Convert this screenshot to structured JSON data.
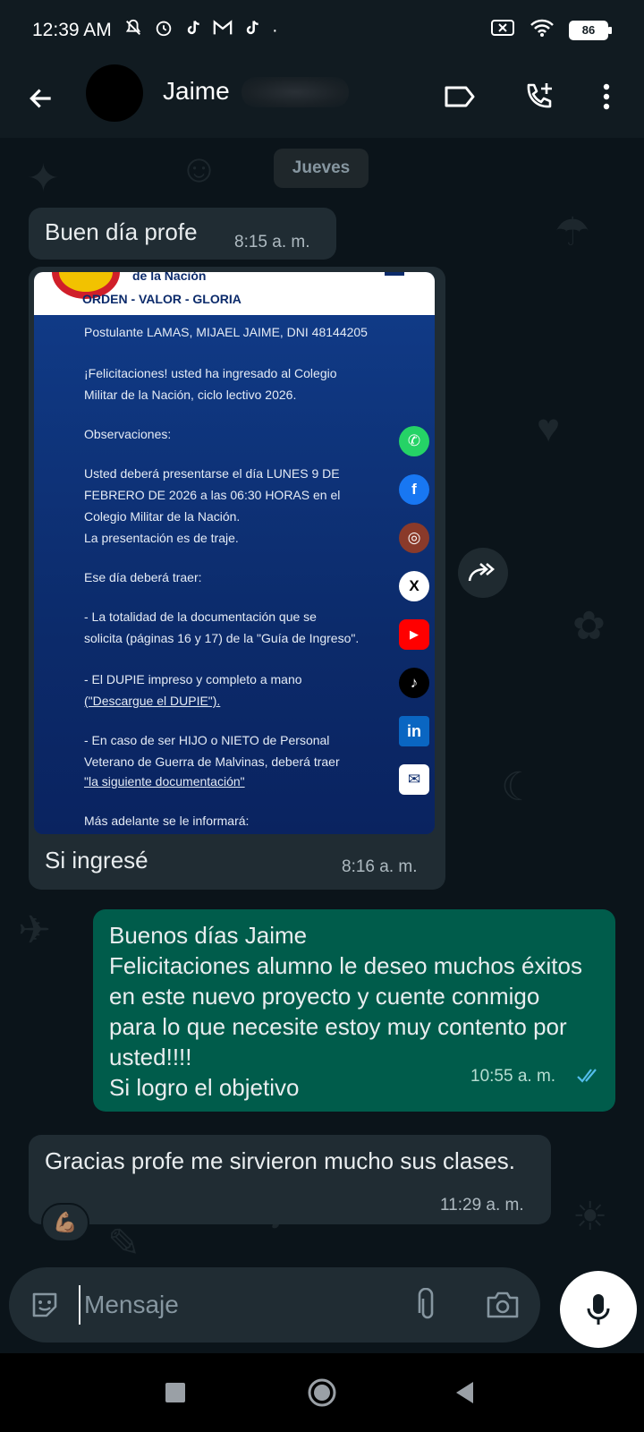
{
  "status_bar": {
    "time": "12:39 AM",
    "battery": "86",
    "icons": [
      "mute-icon",
      "alarm-icon",
      "tiktok-icon",
      "gmail-icon",
      "tiktok-icon",
      "dot-icon",
      "no-sim-icon",
      "wifi-icon",
      "battery-icon"
    ]
  },
  "header": {
    "contact_name": "Jaime",
    "icons": [
      "back-arrow-icon",
      "label-icon",
      "add-call-icon",
      "more-vert-icon"
    ]
  },
  "chat": {
    "date_chip": "Jueves",
    "messages": [
      {
        "direction": "in",
        "text": "Buen día profe",
        "time": "8:15 a. m."
      },
      {
        "direction": "in",
        "type": "image",
        "caption": "Si ingresé",
        "time": "8:16 a. m.",
        "image": {
          "header_fragment": "de la Nación",
          "motto": "ORDEN - VALOR - GLORIA",
          "lines": [
            "Postulante LAMAS, MIJAEL JAIME, DNI 48144205",
            "¡Felicitaciones! usted ha ingresado al Colegio",
            "Militar de la Nación, ciclo lectivo 2026.",
            "Observaciones:",
            "Usted deberá presentarse el día LUNES 9 DE",
            "FEBRERO DE 2026 a las 06:30 HORAS en el",
            "Colegio Militar de la Nación.",
            "La presentación es de traje.",
            "Ese día deberá traer:",
            "- La totalidad de la documentación que se",
            "solicita (páginas 16 y 17) de la \"Guía de Ingreso\".",
            "- El DUPIE impreso y completo a mano",
            "(\"Descargue el DUPIE\").",
            "- En caso de ser HIJO o NIETO de Personal",
            "Veterano de Guerra de Malvinas, deberá traer",
            "\"la siguiente documentación\"",
            "Más adelante se le informará:"
          ],
          "social_icons": [
            "whatsapp-icon",
            "facebook-icon",
            "instagram-icon",
            "x-icon",
            "youtube-icon",
            "tiktok-icon",
            "linkedin-icon",
            "mail-icon"
          ]
        }
      },
      {
        "direction": "out",
        "text": "Buenos días Jaime\nFelicitaciones alumno le deseo muchos éxitos en este nuevo proyecto y cuente conmigo para lo que necesite estoy muy contento por usted!!!!\nSi logro el objetivo",
        "time": "10:55 a. m.",
        "status": "read"
      },
      {
        "direction": "in",
        "text": "Gracias profe me sirvieron mucho sus clases.",
        "time": "11:29 a. m.",
        "reaction": "💪🏽"
      }
    ]
  },
  "composer": {
    "placeholder": "Mensaje",
    "value": ""
  },
  "colors": {
    "background": "#0b141a",
    "bar": "#111b21",
    "incoming_bubble": "#202c33",
    "outgoing_bubble": "#005c4b",
    "read_ticks": "#53bdeb",
    "image_bg": "#0c2b6b"
  }
}
